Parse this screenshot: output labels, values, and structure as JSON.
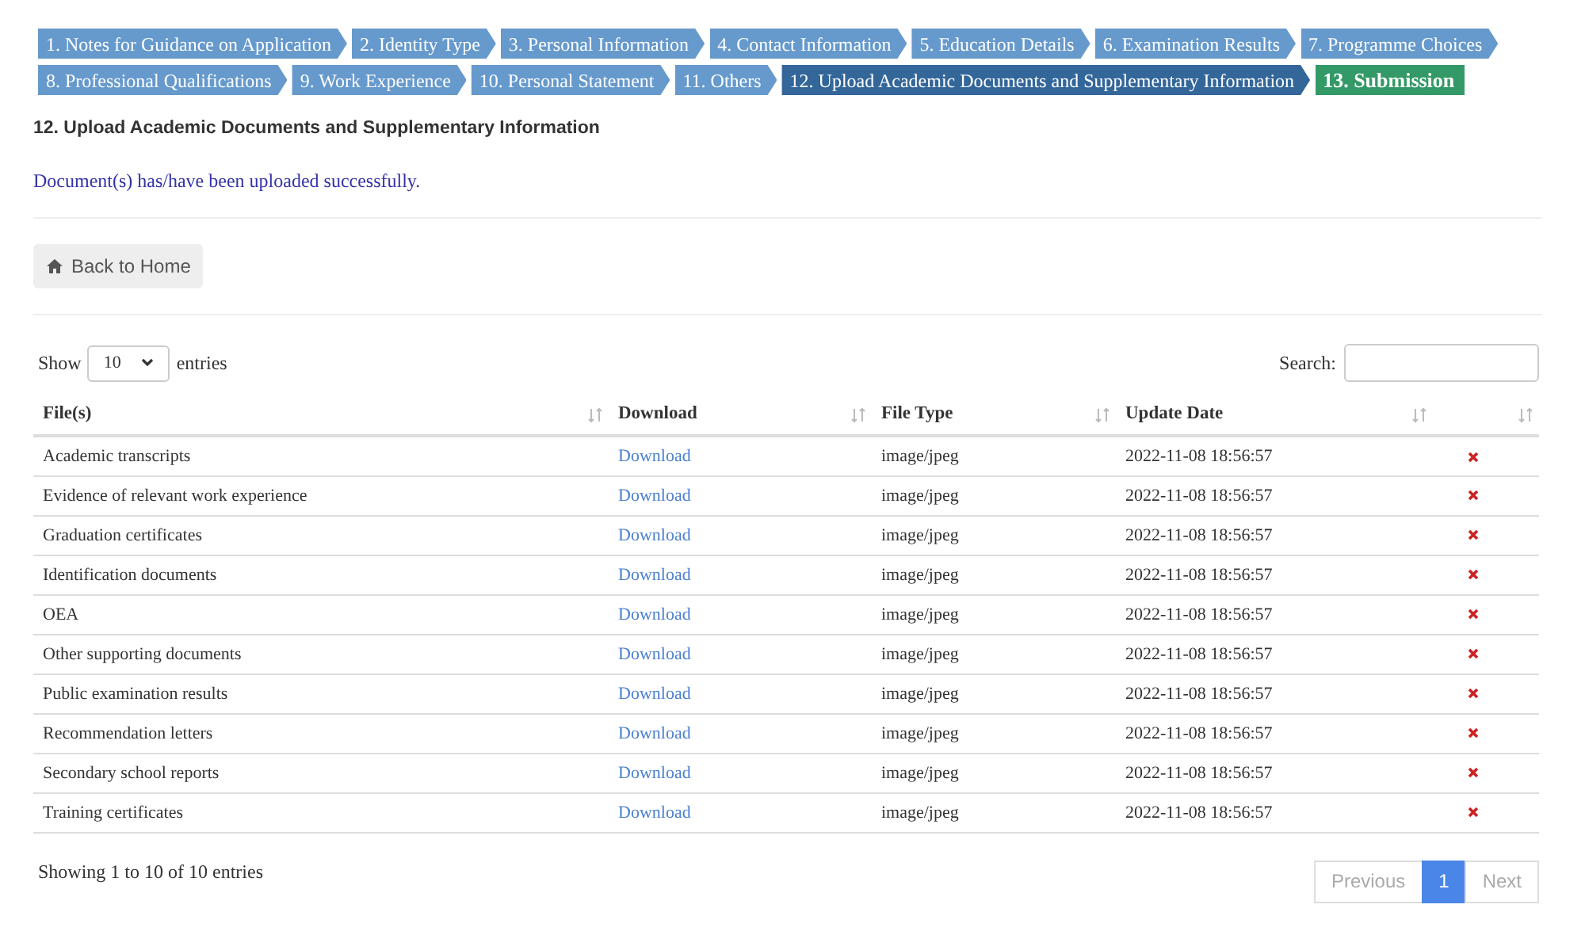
{
  "steps": [
    {
      "label": "1. Notes for Guidance on Application",
      "kind": "done"
    },
    {
      "label": "2. Identity Type",
      "kind": "done"
    },
    {
      "label": "3. Personal Information",
      "kind": "done"
    },
    {
      "label": "4. Contact Information",
      "kind": "done"
    },
    {
      "label": "5. Education Details",
      "kind": "done"
    },
    {
      "label": "6. Examination Results",
      "kind": "done"
    },
    {
      "label": "7. Programme Choices",
      "kind": "done"
    },
    {
      "label": "8. Professional Qualifications",
      "kind": "done"
    },
    {
      "label": "9. Work Experience",
      "kind": "done"
    },
    {
      "label": "10. Personal Statement",
      "kind": "done"
    },
    {
      "label": "11. Others",
      "kind": "done"
    },
    {
      "label": "12. Upload Academic Documents and Supplementary Information",
      "kind": "current"
    },
    {
      "label": "13. Submission",
      "kind": "submit"
    }
  ],
  "heading": "12. Upload Academic Documents and Supplementary Information",
  "message": "Document(s) has/have been uploaded successfully.",
  "back_button": "Back to Home",
  "length_menu": {
    "before": "Show",
    "value": "10",
    "after": "entries"
  },
  "search": {
    "label": "Search:"
  },
  "table": {
    "columns": [
      "File(s)",
      "Download",
      "File Type",
      "Update Date"
    ],
    "rows": [
      {
        "file": "Academic transcripts",
        "download": "Download",
        "type": "image/jpeg",
        "date": "2022-11-08 18:56:57"
      },
      {
        "file": "Evidence of relevant work experience",
        "download": "Download",
        "type": "image/jpeg",
        "date": "2022-11-08 18:56:57"
      },
      {
        "file": "Graduation certificates",
        "download": "Download",
        "type": "image/jpeg",
        "date": "2022-11-08 18:56:57"
      },
      {
        "file": "Identification documents",
        "download": "Download",
        "type": "image/jpeg",
        "date": "2022-11-08 18:56:57"
      },
      {
        "file": "OEA",
        "download": "Download",
        "type": "image/jpeg",
        "date": "2022-11-08 18:56:57"
      },
      {
        "file": "Other supporting documents",
        "download": "Download",
        "type": "image/jpeg",
        "date": "2022-11-08 18:56:57"
      },
      {
        "file": "Public examination results",
        "download": "Download",
        "type": "image/jpeg",
        "date": "2022-11-08 18:56:57"
      },
      {
        "file": "Recommendation letters",
        "download": "Download",
        "type": "image/jpeg",
        "date": "2022-11-08 18:56:57"
      },
      {
        "file": "Secondary school reports",
        "download": "Download",
        "type": "image/jpeg",
        "date": "2022-11-08 18:56:57"
      },
      {
        "file": "Training certificates",
        "download": "Download",
        "type": "image/jpeg",
        "date": "2022-11-08 18:56:57"
      }
    ]
  },
  "info": "Showing 1 to 10 of 10 entries",
  "pagination": [
    {
      "label": "Previous",
      "kind": "nav",
      "disabled": true
    },
    {
      "label": "1",
      "kind": "page",
      "selected": true
    },
    {
      "label": "Next",
      "kind": "nav",
      "disabled": true
    }
  ]
}
